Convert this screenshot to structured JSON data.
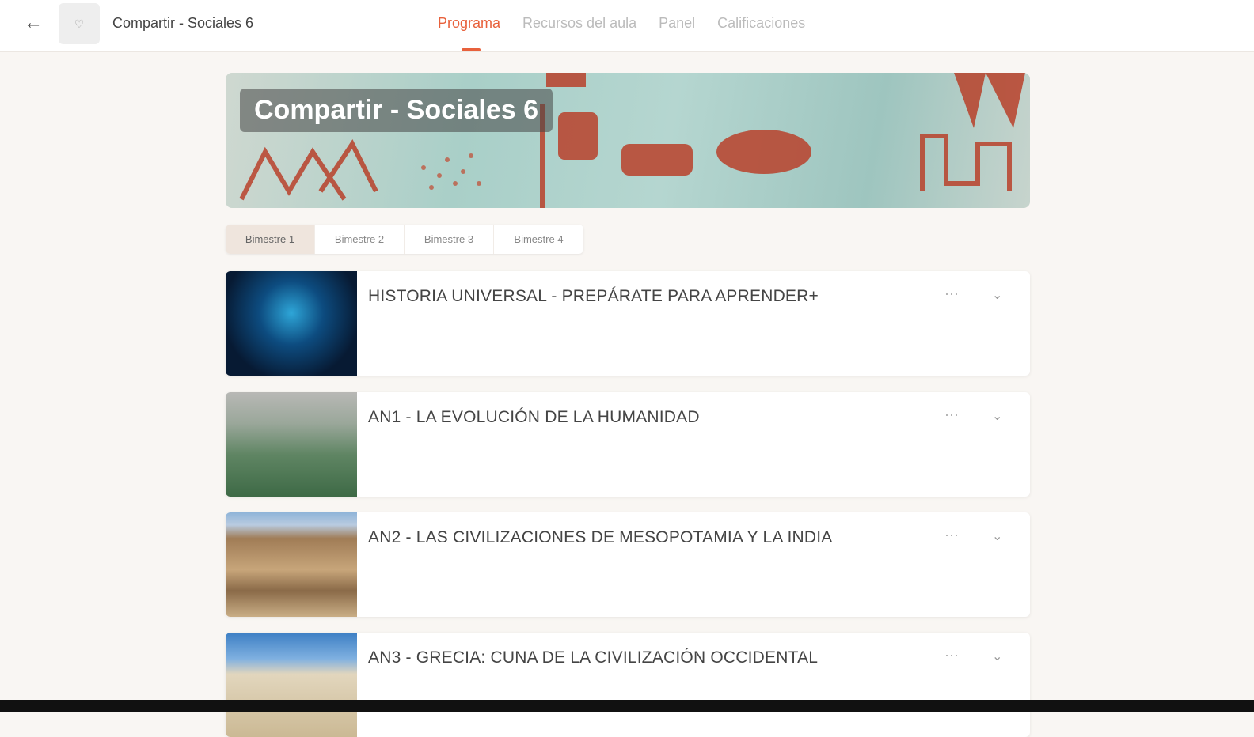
{
  "header": {
    "course_name": "Compartir - Sociales 6",
    "tabs": [
      {
        "label": "Programa"
      },
      {
        "label": "Recursos del aula"
      },
      {
        "label": "Panel"
      },
      {
        "label": "Calificaciones"
      }
    ]
  },
  "banner": {
    "title": "Compartir - Sociales 6"
  },
  "periods": [
    {
      "label": "Bimestre 1"
    },
    {
      "label": "Bimestre 2"
    },
    {
      "label": "Bimestre 3"
    },
    {
      "label": "Bimestre 4"
    }
  ],
  "units": [
    {
      "title": "HISTORIA UNIVERSAL - PREPÁRATE PARA APRENDER+"
    },
    {
      "title": "AN1 - LA EVOLUCIÓN DE LA HUMANIDAD"
    },
    {
      "title": "AN2 - LAS CIVILIZACIONES DE MESOPOTAMIA Y LA INDIA"
    },
    {
      "title": "AN3 - GRECIA: CUNA DE LA CIVILIZACIÓN OCCIDENTAL"
    }
  ],
  "colors": {
    "accent": "#e8613c"
  }
}
